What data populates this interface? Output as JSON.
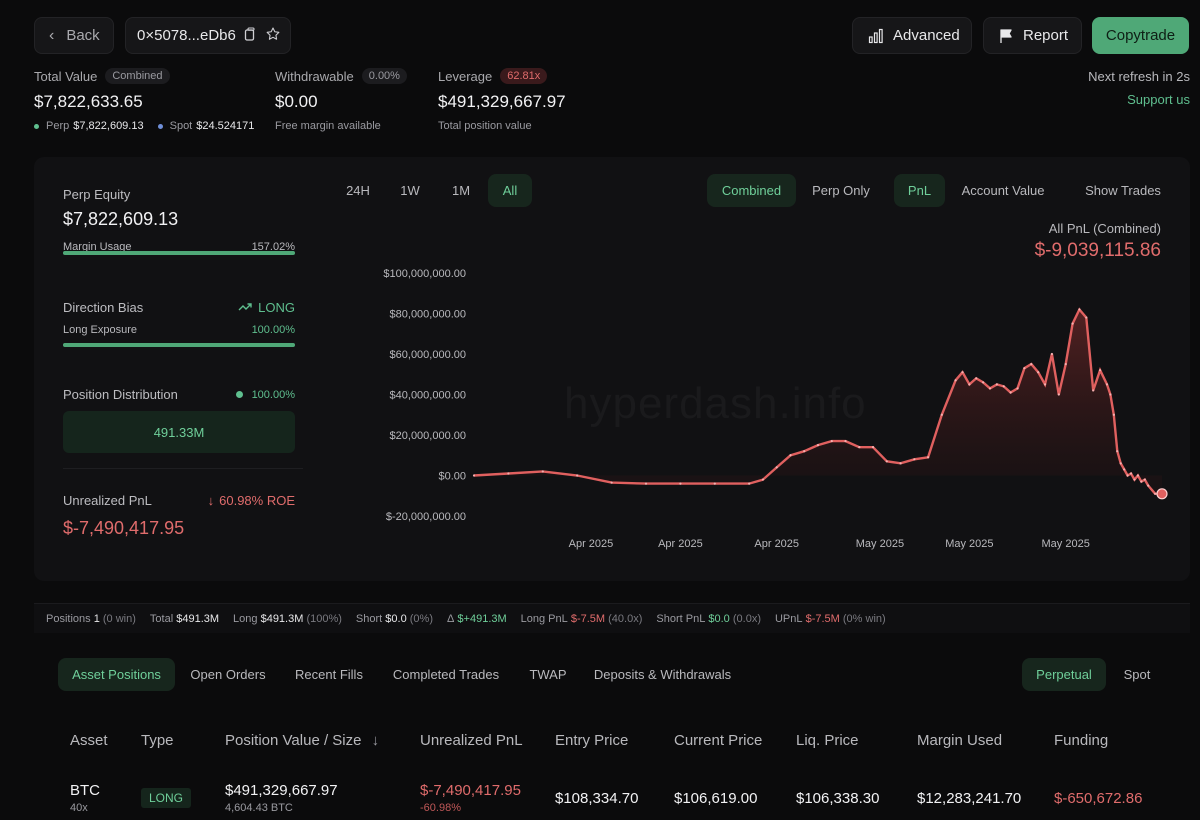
{
  "header": {
    "back_label": "Back",
    "address": "0×5078...eDb6",
    "advanced_label": "Advanced",
    "report_label": "Report",
    "copytrade_label": "Copytrade"
  },
  "summary": {
    "total_value": {
      "label": "Total Value",
      "badge": "Combined",
      "value": "$7,822,633.65",
      "perp_label": "Perp",
      "perp_value": "$7,822,609.13",
      "spot_label": "Spot",
      "spot_value": "$24.524171"
    },
    "withdrawable": {
      "label": "Withdrawable",
      "badge": "0.00%",
      "value": "$0.00",
      "sub": "Free margin available"
    },
    "leverage": {
      "label": "Leverage",
      "badge": "62.81x",
      "value": "$491,329,667.97",
      "sub": "Total position value"
    },
    "refresh": "Next refresh in 2s",
    "support": "Support us"
  },
  "left_panel": {
    "perp_equity_label": "Perp Equity",
    "perp_equity_value": "$7,822,609.13",
    "margin_usage_label": "Margin Usage",
    "margin_usage_value": "157.02%",
    "margin_usage_fraction": 1.0,
    "direction_bias_label": "Direction Bias",
    "direction_bias_value": "LONG",
    "long_exposure_label": "Long Exposure",
    "long_exposure_value": "100.00%",
    "long_exposure_fraction": 1.0,
    "position_distribution_label": "Position Distribution",
    "position_distribution_value": "100.00%",
    "distribution_amount": "491.33M",
    "unrealized_pnl_label": "Unrealized PnL",
    "roe_value": "60.98% ROE",
    "unrealized_pnl_value": "$-7,490,417.95"
  },
  "chart_controls": {
    "ranges": [
      "24H",
      "1W",
      "1M",
      "All"
    ],
    "active_range": "All",
    "modes": [
      "Combined",
      "Perp Only"
    ],
    "active_mode": "Combined",
    "metrics": [
      "PnL",
      "Account Value"
    ],
    "active_metric": "PnL",
    "show_trades": "Show Trades"
  },
  "pnl_summary": {
    "title": "All PnL (Combined)",
    "value": "$-9,039,115.86"
  },
  "watermark": "hyperdash.info",
  "chart_data": {
    "type": "area",
    "title": "",
    "ylabel": "",
    "xlabel": "",
    "ylim": [
      -20000000,
      100000000
    ],
    "y_ticks": [
      "$100,000,000.00",
      "$80,000,000.00",
      "$60,000,000.00",
      "$40,000,000.00",
      "$20,000,000.00",
      "$0.00",
      "$-20,000,000.00"
    ],
    "y_tick_values": [
      100000000,
      80000000,
      60000000,
      40000000,
      20000000,
      0,
      -20000000
    ],
    "x_ticks": [
      "Apr 2025",
      "Apr 2025",
      "Apr 2025",
      "May 2025",
      "May 2025",
      "May 2025"
    ],
    "x_tick_positions": [
      0.17,
      0.3,
      0.44,
      0.59,
      0.72,
      0.86
    ],
    "grid": false,
    "color": "#e0605f",
    "series": [
      {
        "x": [
          0,
          0.05,
          0.1,
          0.15,
          0.2,
          0.25,
          0.3,
          0.35,
          0.4,
          0.42,
          0.44,
          0.46,
          0.48,
          0.5,
          0.52,
          0.54,
          0.56,
          0.58,
          0.6,
          0.62,
          0.64,
          0.66,
          0.68,
          0.7,
          0.71,
          0.72,
          0.73,
          0.74,
          0.75,
          0.76,
          0.77,
          0.78,
          0.79,
          0.8,
          0.81,
          0.82,
          0.83,
          0.84,
          0.85,
          0.86,
          0.87,
          0.88,
          0.89,
          0.9,
          0.91,
          0.92,
          0.925,
          0.93,
          0.935,
          0.94,
          0.945,
          0.95,
          0.955,
          0.96,
          0.965,
          0.97,
          0.975,
          0.98,
          0.99,
          1.0
        ],
        "values": [
          0,
          1000000,
          2000000,
          0,
          -3500000,
          -4000000,
          -4000000,
          -4000000,
          -4000000,
          -2000000,
          4000000,
          10000000,
          12000000,
          15000000,
          17000000,
          17000000,
          14000000,
          14000000,
          7000000,
          6000000,
          8000000,
          9000000,
          30000000,
          47000000,
          51000000,
          45000000,
          48000000,
          46000000,
          43000000,
          45000000,
          44000000,
          41000000,
          43000000,
          53000000,
          55000000,
          51000000,
          45000000,
          60000000,
          40000000,
          55000000,
          75000000,
          82000000,
          78000000,
          42000000,
          52000000,
          45000000,
          40000000,
          30000000,
          12000000,
          6000000,
          3000000,
          0,
          1000000,
          -2000000,
          0,
          -3000000,
          -2000000,
          -5000000,
          -9000000,
          -9039115.86
        ]
      }
    ]
  },
  "stats_strip": {
    "positions_label": "Positions",
    "positions_value": "1",
    "positions_win": "(0 win)",
    "total_label": "Total",
    "total_value": "$491.3M",
    "long_label": "Long",
    "long_value": "$491.3M",
    "long_pct": "(100%)",
    "short_label": "Short",
    "short_value": "$0.0",
    "short_pct": "(0%)",
    "delta_label": "Δ",
    "delta_value": "$+491.3M",
    "long_pnl_label": "Long PnL",
    "long_pnl_value": "$-7.5M",
    "long_pnl_x": "(40.0x)",
    "short_pnl_label": "Short PnL",
    "short_pnl_value": "$0.0",
    "short_pnl_x": "(0.0x)",
    "upnl_label": "UPnL",
    "upnl_value": "$-7.5M",
    "upnl_win": "(0% win)"
  },
  "bottom_tabs": {
    "items": [
      "Asset Positions",
      "Open Orders",
      "Recent Fills",
      "Completed Trades",
      "TWAP",
      "Deposits & Withdrawals"
    ],
    "active": "Asset Positions",
    "market_types": [
      "Perpetual",
      "Spot"
    ],
    "active_market": "Perpetual"
  },
  "table": {
    "headers": [
      "Asset",
      "Type",
      "Position Value / Size",
      "Unrealized PnL",
      "Entry Price",
      "Current Price",
      "Liq. Price",
      "Margin Used",
      "Funding"
    ],
    "rows": [
      {
        "asset": "BTC",
        "leverage": "40x",
        "type": "LONG",
        "position_value": "$491,329,667.97",
        "size": "4,604.43 BTC",
        "unrealized_pnl": "$-7,490,417.95",
        "pnl_pct": "-60.98%",
        "entry_price": "$108,334.70",
        "current_price": "$106,619.00",
        "liq_price": "$106,338.30",
        "margin_used": "$12,283,241.70",
        "funding": "$-650,672.86"
      }
    ]
  }
}
